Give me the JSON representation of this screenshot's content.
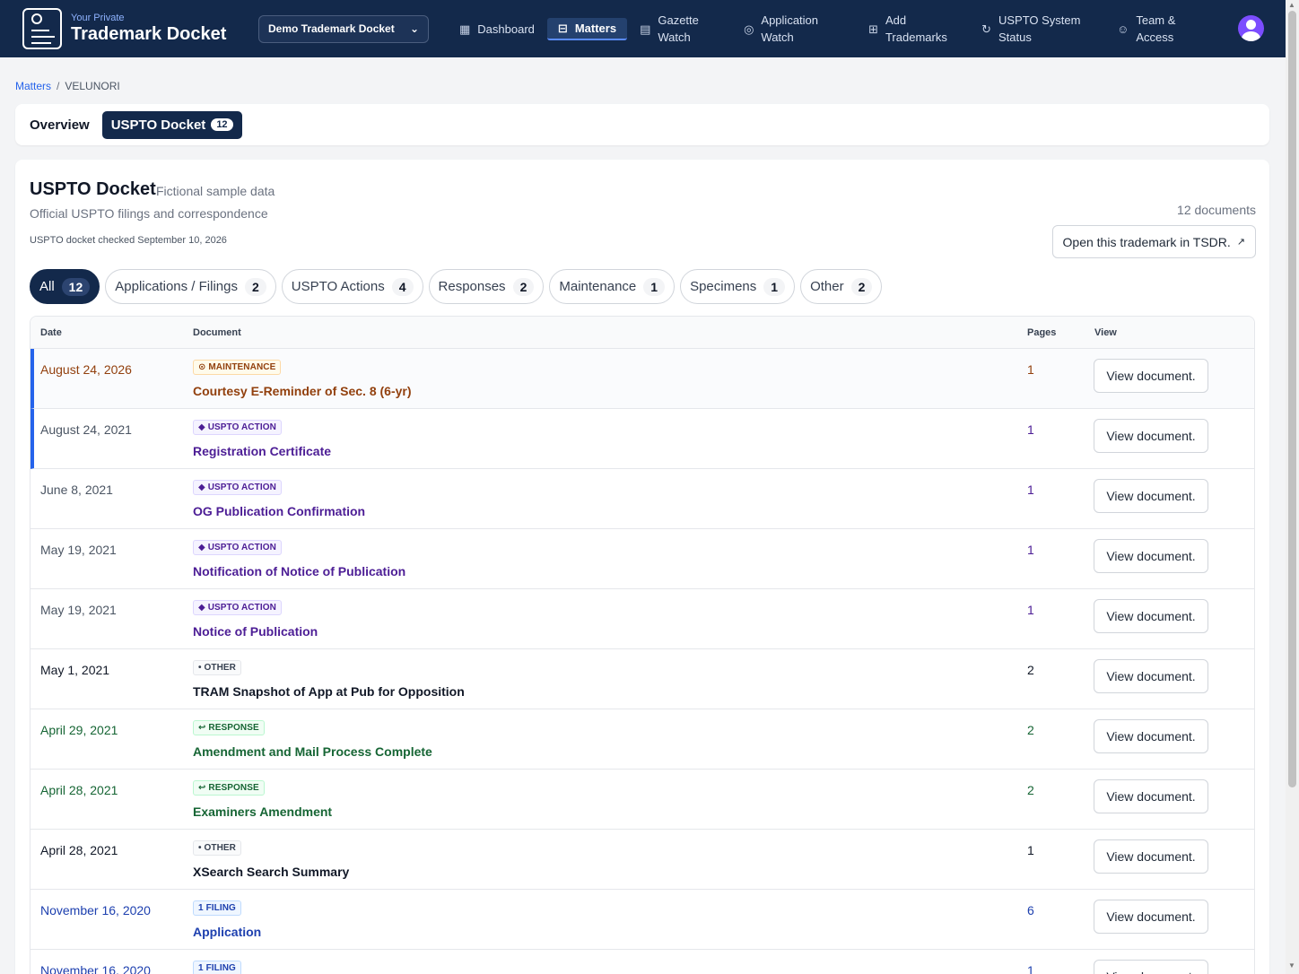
{
  "brand": {
    "small": "Your Private",
    "big": "Trademark Docket"
  },
  "docket_select": {
    "value": "Demo Trademark Docket"
  },
  "nav": [
    {
      "label": "Dashboard",
      "icon": "grid-icon"
    },
    {
      "label": "Matters",
      "icon": "briefcase-icon",
      "active": true
    },
    {
      "label_1": "Gazette",
      "label_2": "Watch",
      "icon": "newspaper-icon"
    },
    {
      "label_1": "Application",
      "label_2": "Watch",
      "icon": "radar-icon"
    },
    {
      "label_1": "Add",
      "label_2": "Trademarks",
      "icon": "file-plus-icon"
    },
    {
      "label_1": "USPTO System",
      "label_2": "Status",
      "icon": "refresh-icon"
    },
    {
      "label_1": "Team &",
      "label_2": "Access",
      "icon": "user-icon"
    }
  ],
  "breadcrumb": {
    "link": "Matters",
    "sep": "/",
    "current": "VELUNORI"
  },
  "tabs": [
    {
      "label": "Overview"
    },
    {
      "label": "USPTO Docket",
      "count": "12"
    }
  ],
  "docket": {
    "title": "USPTO Docket",
    "subtitle": "Fictional sample data",
    "description": "Official USPTO filings and correspondence",
    "checked": "USPTO docket checked September 10, 2026",
    "doc_count": "12 documents",
    "tsdr_button": "Open this trademark in TSDR.",
    "tsdr_arrow": "↗"
  },
  "filters": [
    {
      "label": "All",
      "count": "12",
      "active": true
    },
    {
      "label": "Applications / Filings",
      "count": "2"
    },
    {
      "label": "USPTO Actions",
      "count": "4"
    },
    {
      "label": "Responses",
      "count": "2"
    },
    {
      "label": "Maintenance",
      "count": "1"
    },
    {
      "label": "Specimens",
      "count": "1"
    },
    {
      "label": "Other",
      "count": "2"
    }
  ],
  "table": {
    "headers": {
      "date": "Date",
      "document": "Document",
      "pages": "Pages",
      "view": "View"
    },
    "view_label": "View document.",
    "rows": [
      {
        "date": "August 24, 2026",
        "badge": "MAINTENANCE",
        "badge_icon": "⊙",
        "title": "Courtesy E-Reminder of Sec. 8 (6-yr)",
        "pages": "1",
        "kind": "maint"
      },
      {
        "date": "August 24, 2021",
        "badge": "USPTO ACTION",
        "badge_icon": "◆",
        "title": "Registration Certificate",
        "pages": "1",
        "kind": "action"
      },
      {
        "date": "June 8, 2021",
        "badge": "USPTO ACTION",
        "badge_icon": "◆",
        "title": "OG Publication Confirmation",
        "pages": "1",
        "kind": "action"
      },
      {
        "date": "May 19, 2021",
        "badge": "USPTO ACTION",
        "badge_icon": "◆",
        "title": "Notification of Notice of Publication",
        "pages": "1",
        "kind": "action"
      },
      {
        "date": "May 19, 2021",
        "badge": "USPTO ACTION",
        "badge_icon": "◆",
        "title": "Notice of Publication",
        "pages": "1",
        "kind": "action"
      },
      {
        "date": "May 1, 2021",
        "badge": "OTHER",
        "badge_icon": "•",
        "title": "TRAM Snapshot of App at Pub for Opposition",
        "pages": "2",
        "kind": "other"
      },
      {
        "date": "April 29, 2021",
        "badge": "RESPONSE",
        "badge_icon": "↩",
        "title": "Amendment and Mail Process Complete",
        "pages": "2",
        "kind": "resp"
      },
      {
        "date": "April 28, 2021",
        "badge": "RESPONSE",
        "badge_icon": "↩",
        "title": "Examiners Amendment",
        "pages": "2",
        "kind": "resp"
      },
      {
        "date": "April 28, 2021",
        "badge": "OTHER",
        "badge_icon": "•",
        "title": "XSearch Search Summary",
        "pages": "1",
        "kind": "other"
      },
      {
        "date": "November 16, 2020",
        "badge": "FILING",
        "badge_icon": "1",
        "title": "Application",
        "pages": "6",
        "kind": "filing"
      },
      {
        "date": "November 16, 2020",
        "badge": "FILING",
        "badge_icon": "1",
        "title": "",
        "pages": "1",
        "kind": "filing"
      }
    ]
  }
}
